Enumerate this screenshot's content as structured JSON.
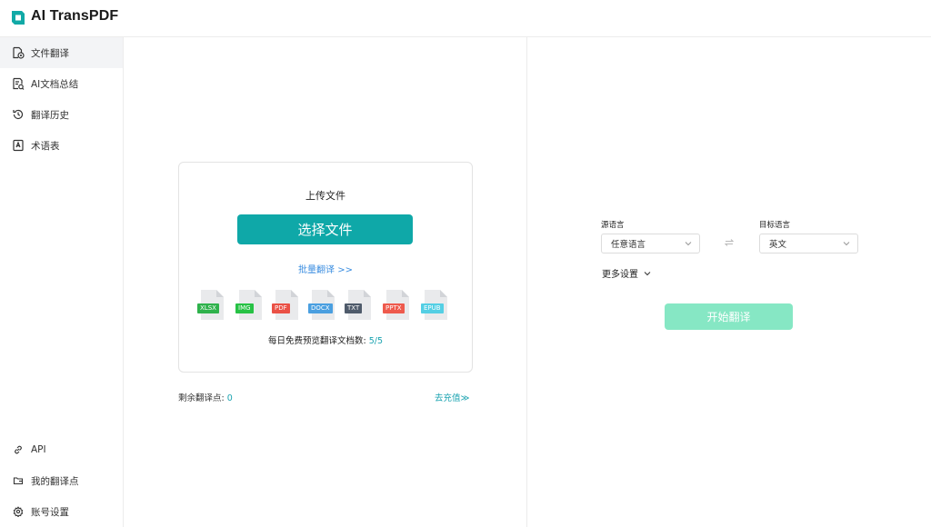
{
  "app": {
    "title": "AI TransPDF"
  },
  "sidebar": {
    "items": [
      {
        "label": "文件翻译",
        "icon": "file-translate-icon",
        "active": true
      },
      {
        "label": "AI文档总结",
        "icon": "doc-summary-icon",
        "active": false
      },
      {
        "label": "翻译历史",
        "icon": "history-icon",
        "active": false
      },
      {
        "label": "术语表",
        "icon": "glossary-icon",
        "active": false
      }
    ],
    "bottom_items": [
      {
        "label": "API",
        "icon": "link-icon"
      },
      {
        "label": "我的翻译点",
        "icon": "folder-icon"
      },
      {
        "label": "账号设置",
        "icon": "gear-icon"
      }
    ]
  },
  "upload": {
    "title": "上传文件",
    "choose_button": "选择文件",
    "batch_link": "批量翻译 >>",
    "file_types": [
      {
        "label": "XLSX",
        "color": "#2fb24c"
      },
      {
        "label": "IMG",
        "color": "#27c245"
      },
      {
        "label": "PDF",
        "color": "#ea5146"
      },
      {
        "label": "DOCX",
        "color": "#4a9fe0"
      },
      {
        "label": "TXT",
        "color": "#4f5b6b"
      },
      {
        "label": "PPTX",
        "color": "#ee5a4d"
      },
      {
        "label": "EPUB",
        "color": "#54cfe4"
      }
    ],
    "quota_label": "每日免费预览翻译文档数:",
    "quota_value": "5/5"
  },
  "points": {
    "label": "剩余翻译点:",
    "value": "0",
    "recharge_link": "去充值≫"
  },
  "translate": {
    "source_label": "源语言",
    "source_value": "任意语言",
    "target_label": "目标语言",
    "target_value": "英文",
    "more_settings": "更多设置",
    "start_button": "开始翻译"
  },
  "colors": {
    "accent": "#0fa8a8",
    "start_button": "#86e7c4",
    "link": "#3a8de0",
    "highlight": "#1aa3b0"
  }
}
